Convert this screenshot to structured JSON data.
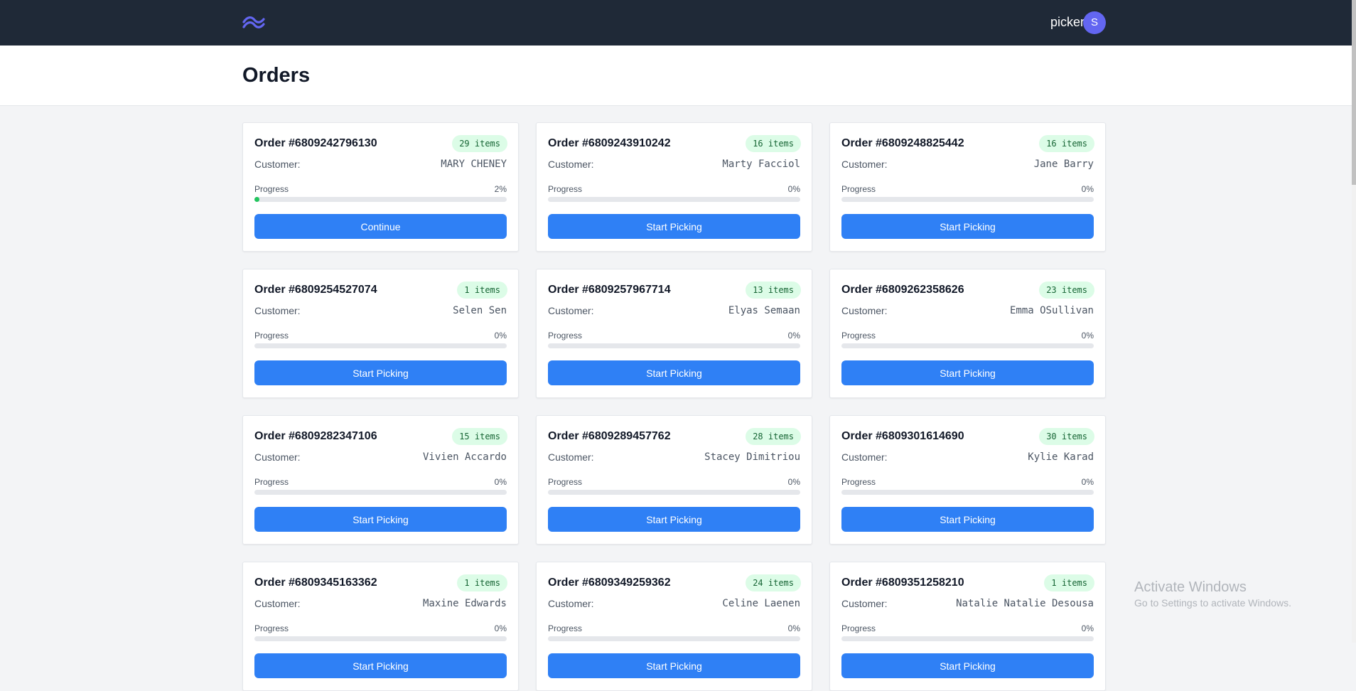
{
  "nav": {
    "username": "picker",
    "avatar_initial": "S"
  },
  "page": {
    "title": "Orders"
  },
  "labels": {
    "customer": "Customer:",
    "progress": "Progress"
  },
  "orders": [
    {
      "title": "Order #6809242796130",
      "items": "29 items",
      "customer": "MARY CHENEY",
      "progress": 2,
      "progress_text": "2%",
      "action": "Continue"
    },
    {
      "title": "Order #6809243910242",
      "items": "16 items",
      "customer": "Marty Facciol",
      "progress": 0,
      "progress_text": "0%",
      "action": "Start Picking"
    },
    {
      "title": "Order #6809248825442",
      "items": "16 items",
      "customer": "Jane Barry",
      "progress": 0,
      "progress_text": "0%",
      "action": "Start Picking"
    },
    {
      "title": "Order #6809254527074",
      "items": "1 items",
      "customer": "Selen Sen",
      "progress": 0,
      "progress_text": "0%",
      "action": "Start Picking"
    },
    {
      "title": "Order #6809257967714",
      "items": "13 items",
      "customer": "Elyas Semaan",
      "progress": 0,
      "progress_text": "0%",
      "action": "Start Picking"
    },
    {
      "title": "Order #6809262358626",
      "items": "23 items",
      "customer": "Emma OSullivan",
      "progress": 0,
      "progress_text": "0%",
      "action": "Start Picking"
    },
    {
      "title": "Order #6809282347106",
      "items": "15 items",
      "customer": "Vivien Accardo",
      "progress": 0,
      "progress_text": "0%",
      "action": "Start Picking"
    },
    {
      "title": "Order #6809289457762",
      "items": "28 items",
      "customer": "Stacey Dimitriou",
      "progress": 0,
      "progress_text": "0%",
      "action": "Start Picking"
    },
    {
      "title": "Order #6809301614690",
      "items": "30 items",
      "customer": "Kylie Karad",
      "progress": 0,
      "progress_text": "0%",
      "action": "Start Picking"
    },
    {
      "title": "Order #6809345163362",
      "items": "1 items",
      "customer": "Maxine Edwards",
      "progress": 0,
      "progress_text": "0%",
      "action": "Start Picking"
    },
    {
      "title": "Order #6809349259362",
      "items": "24 items",
      "customer": "Celine Laenen",
      "progress": 0,
      "progress_text": "0%",
      "action": "Start Picking"
    },
    {
      "title": "Order #6809351258210",
      "items": "1 items",
      "customer": "Natalie Natalie Desousa",
      "progress": 0,
      "progress_text": "0%",
      "action": "Start Picking"
    }
  ],
  "watermark": {
    "title": "Activate Windows",
    "subtitle": "Go to Settings to activate Windows."
  },
  "colors": {
    "nav_bg": "#1f2937",
    "logo": "#6366f1",
    "avatar": "#6366f1",
    "button": "#2f80f5",
    "badge_bg": "#dcfce7",
    "badge_text": "#166534",
    "progress_fill": "#22c55e"
  },
  "icons": {
    "logo": "tailwind-wave-logo"
  }
}
